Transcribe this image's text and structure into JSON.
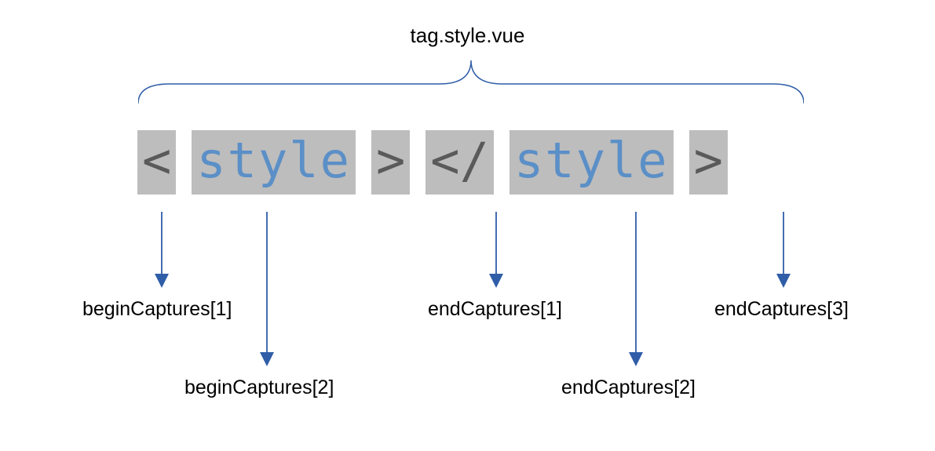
{
  "title": "tag.style.vue",
  "tokens": {
    "t1": "<",
    "t2": "style",
    "t3": ">",
    "t4": "</",
    "t5": "style",
    "t6": ">"
  },
  "labels": {
    "bc1": "beginCaptures[1]",
    "bc2": "beginCaptures[2]",
    "ec1": "endCaptures[1]",
    "ec2": "endCaptures[2]",
    "ec3": "endCaptures[3]"
  },
  "colors": {
    "arrow": "#2f5da8",
    "token_bg": "#bdbdbd",
    "token_gray": "#5a5a5a",
    "token_blue": "#5b8fc7"
  }
}
